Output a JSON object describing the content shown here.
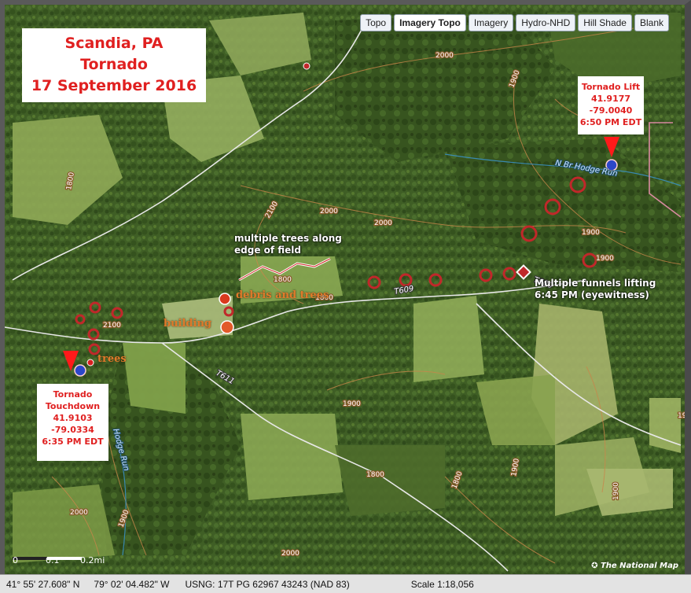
{
  "layers": [
    "Topo",
    "Imagery Topo",
    "Imagery",
    "Hydro-NHD",
    "Hill Shade",
    "Blank"
  ],
  "active_layer": "Imagery Topo",
  "title": {
    "line1": "Scandia, PA",
    "line2": "Tornado",
    "line3": "17 September 2016"
  },
  "lift": {
    "line1": "Tornado Lift",
    "line2": "41.9177",
    "line3": "-79.0040",
    "line4": "6:50 PM EDT"
  },
  "touchdown": {
    "line1": "Tornado",
    "line2": "Touchdown",
    "line3": "41.9103",
    "line4": "-79.0334",
    "line5": "6:35 PM EDT"
  },
  "annotations": {
    "trees_along_field_1": "multiple trees along",
    "trees_along_field_2": "edge of field",
    "funnels_1": "Multiple funnels lifting",
    "funnels_2": "6:45 PM (eyewitness)",
    "debris": "debris and trees",
    "building": "building",
    "trees": "trees"
  },
  "map_labels": {
    "contours": [
      "2000",
      "1900",
      "1800",
      "2100",
      "2000",
      "1900",
      "1800",
      "1900",
      "1800",
      "1900",
      "1900",
      "2000",
      "1900",
      "2000",
      "1800",
      "1900",
      "2100",
      "2000",
      "1900",
      "1800"
    ],
    "roads": [
      "T609",
      "T611",
      "T600"
    ],
    "streams": [
      "N Br Hodge Run",
      "Hodge Run"
    ]
  },
  "scale_bar": {
    "labels": [
      "0",
      "0.1",
      "0.2mi"
    ]
  },
  "credit": "The National Map",
  "status": {
    "lat": "41° 55' 27.608\" N",
    "lon": "79° 02' 04.482\" W",
    "usng": "USNG: 17T PG 62967 43243 (NAD 83)",
    "scale": "Scale  1:18,056"
  },
  "colors": {
    "accent": "#e02020",
    "contour": "#c8864a",
    "road": "#e8e8e8",
    "stream": "#3a8fbf"
  }
}
